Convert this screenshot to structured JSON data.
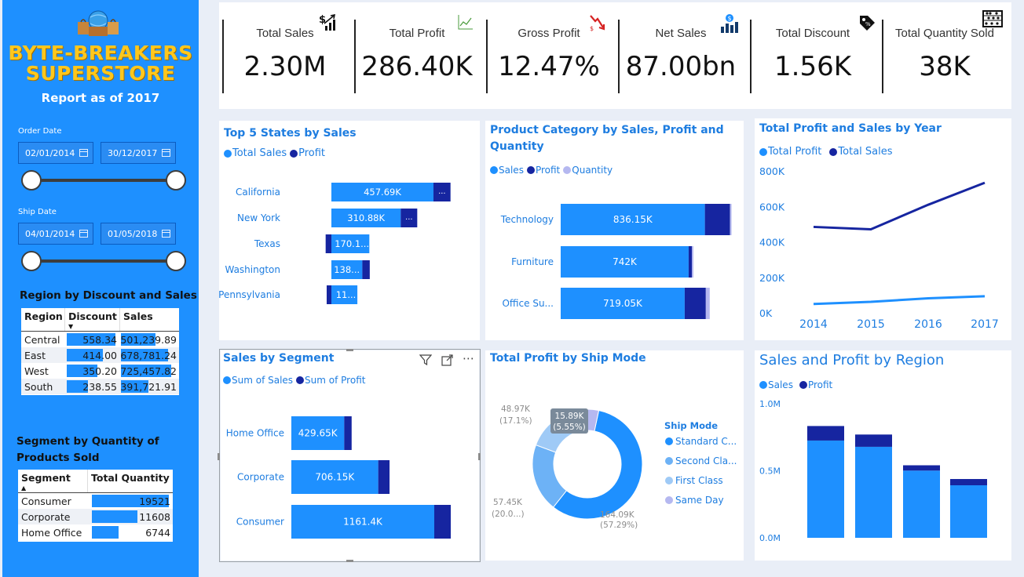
{
  "sidebar": {
    "brand_line1": "BYTE-BREAKERS",
    "brand_line2": "SUPERSTORE",
    "report_label": "Report as of 2017",
    "order_date": {
      "label": "Order Date",
      "start": "02/01/2014",
      "end": "30/12/2017"
    },
    "ship_date": {
      "label": "Ship Date",
      "start": "04/01/2014",
      "end": "01/05/2018"
    },
    "region_table": {
      "title": "Region by Discount and Sales",
      "headers": [
        "Region",
        "Discount",
        "Sales"
      ],
      "rows": [
        {
          "region": "Central",
          "discount": "558.34",
          "sales": "501,239.89",
          "discount_frac": 1.0,
          "sales_frac": 0.69
        },
        {
          "region": "East",
          "discount": "414.00",
          "sales": "678,781.24",
          "discount_frac": 0.74,
          "sales_frac": 0.94
        },
        {
          "region": "West",
          "discount": "350.20",
          "sales": "725,457.82",
          "discount_frac": 0.63,
          "sales_frac": 1.0
        },
        {
          "region": "South",
          "discount": "238.55",
          "sales": "391,721.91",
          "discount_frac": 0.43,
          "sales_frac": 0.54
        }
      ]
    },
    "segment_table": {
      "title_line1": "Segment by Quantity of",
      "title_line2": "Products Sold",
      "headers": [
        "Segment",
        "Total Quantity"
      ],
      "rows": [
        {
          "segment": "Consumer",
          "qty": "19521",
          "frac": 1.0
        },
        {
          "segment": "Corporate",
          "qty": "11608",
          "frac": 0.59
        },
        {
          "segment": "Home Office",
          "qty": "6744",
          "frac": 0.35
        }
      ]
    }
  },
  "kpis": [
    {
      "label": "Total Sales",
      "value": "2.30M",
      "icon": "sales-chart-icon"
    },
    {
      "label": "Total Profit",
      "value": "286.40K",
      "icon": "profit-line-icon"
    },
    {
      "label": "Gross Profit",
      "value": "12.47%",
      "icon": "trend-down-icon"
    },
    {
      "label": "Net Sales",
      "value": "87.00bn",
      "icon": "money-bars-icon"
    },
    {
      "label": "Total Discount",
      "value": "1.56K",
      "icon": "price-tag-icon"
    },
    {
      "label": "Total Quantity Sold",
      "value": "38K",
      "icon": "abacus-icon"
    }
  ],
  "colors": {
    "sales": "#1e90ff",
    "profit": "#1625a0",
    "quantity": "#b5b8f0",
    "accent": "#1e7de0"
  },
  "cards": {
    "top_states": {
      "title": "Top 5 States by Sales",
      "legend": [
        "Total Sales",
        "Profit"
      ]
    },
    "category": {
      "title_line1": "Product Category by Sales, Profit and",
      "title_line2": "Quantity",
      "legend": [
        "Sales",
        "Profit",
        "Quantity"
      ]
    },
    "year": {
      "title": "Total Profit and Sales by Year",
      "legend": [
        "Total Profit",
        "Total Sales"
      ]
    },
    "segment": {
      "title": "Sales by Segment",
      "legend": [
        "Sum of Sales",
        "Sum of Profit"
      ]
    },
    "ship_mode": {
      "title": "Total Profit by Ship Mode",
      "legend_title": "Ship Mode"
    },
    "region": {
      "title": "Sales and Profit by Region",
      "legend": [
        "Sales",
        "Profit"
      ]
    }
  },
  "chart_data": [
    {
      "type": "bar",
      "title": "Top 5 States by Sales",
      "orientation": "horizontal",
      "categories": [
        "California",
        "New York",
        "Texas",
        "Washington",
        "Pennsylvania"
      ],
      "series": [
        {
          "name": "Total Sales",
          "values": [
            457690,
            310880,
            170190,
            138640,
            116510
          ],
          "labels": [
            "457.69K",
            "310.88K",
            "170.1...",
            "138...",
            "11..."
          ]
        },
        {
          "name": "Profit",
          "values": [
            76380,
            74040,
            -25730,
            33400,
            -15560
          ],
          "labels": [
            "...",
            "...",
            "",
            "",
            ""
          ]
        }
      ]
    },
    {
      "type": "bar",
      "title": "Product Category by Sales, Profit and Quantity",
      "orientation": "horizontal",
      "categories": [
        "Technology",
        "Furniture",
        "Office Su..."
      ],
      "series": [
        {
          "name": "Sales",
          "values": [
            836150,
            742000,
            719050
          ],
          "labels": [
            "836.15K",
            "742K",
            "719.05K"
          ]
        },
        {
          "name": "Profit",
          "values": [
            145450,
            18450,
            122490
          ]
        },
        {
          "name": "Quantity",
          "values": [
            6939,
            8028,
            22906
          ]
        }
      ]
    },
    {
      "type": "line",
      "title": "Total Profit and Sales by Year",
      "x": [
        "2014",
        "2015",
        "2016",
        "2017"
      ],
      "y_ticks": [
        "0K",
        "200K",
        "400K",
        "600K",
        "800K"
      ],
      "ylim": [
        0,
        800000
      ],
      "series": [
        {
          "name": "Total Profit",
          "values": [
            49540,
            61620,
            81800,
            93440
          ]
        },
        {
          "name": "Total Sales",
          "values": [
            484250,
            470530,
            609210,
            733220
          ]
        }
      ]
    },
    {
      "type": "bar",
      "title": "Sales by Segment",
      "orientation": "horizontal",
      "categories": [
        "Home Office",
        "Corporate",
        "Consumer"
      ],
      "series": [
        {
          "name": "Sum of Sales",
          "values": [
            429650,
            706150,
            1161400
          ],
          "labels": [
            "429.65K",
            "706.15K",
            "1161.4K"
          ]
        },
        {
          "name": "Sum of Profit",
          "values": [
            60300,
            91980,
            134120
          ]
        }
      ]
    },
    {
      "type": "pie",
      "title": "Total Profit by Ship Mode",
      "categories": [
        "Standard C...",
        "Second Cla...",
        "First Class",
        "Same Day"
      ],
      "values": [
        164090,
        57450,
        48970,
        15890
      ],
      "labels": [
        "164.09K",
        "57.45K",
        "48.97K",
        "15.89K"
      ],
      "percents": [
        "(57.29%)",
        "(20.0...)",
        "(17.1%)",
        "(5.55%)"
      ]
    },
    {
      "type": "bar",
      "title": "Sales and Profit by Region",
      "categories": [
        "West",
        "East",
        "Central",
        "South"
      ],
      "y_ticks": [
        "0.0M",
        "0.5M",
        "1.0M"
      ],
      "ylim": [
        0,
        1000000
      ],
      "series": [
        {
          "name": "Sales",
          "values": [
            725460,
            678780,
            501240,
            391720
          ]
        },
        {
          "name": "Profit",
          "values": [
            108420,
            91520,
            39710,
            46750
          ]
        }
      ]
    }
  ]
}
